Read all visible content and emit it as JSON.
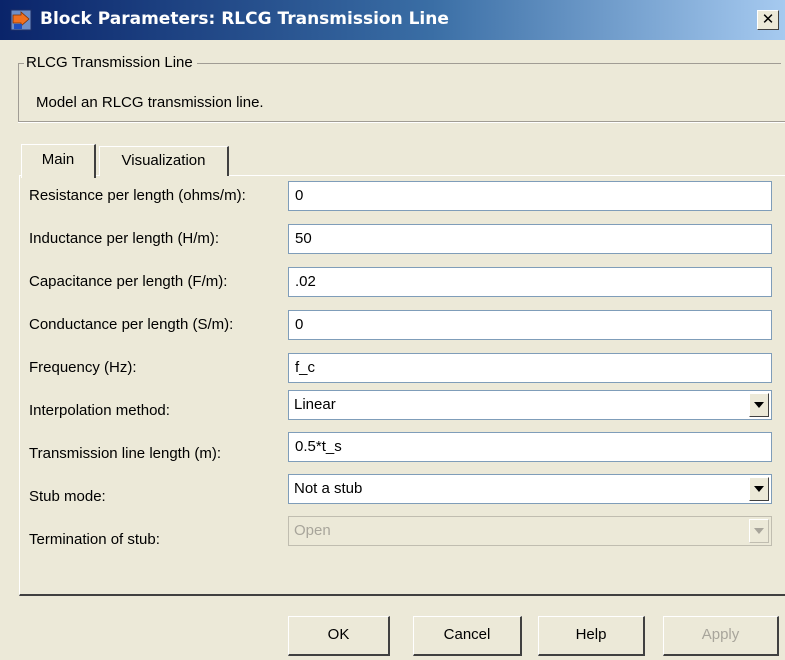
{
  "window": {
    "title": "Block Parameters: RLCG Transmission Line",
    "close_label": "✕"
  },
  "group": {
    "legend": "RLCG Transmission Line",
    "description": "Model an RLCG transmission line."
  },
  "tabs": [
    {
      "label": "Main",
      "active": true
    },
    {
      "label": "Visualization",
      "active": false
    }
  ],
  "params": [
    {
      "label": "Resistance per length (ohms/m):",
      "value": "0"
    },
    {
      "label": "Inductance per length (H/m):",
      "value": "50"
    },
    {
      "label": "Capacitance per length (F/m):",
      "value": ".02"
    },
    {
      "label": "Conductance per length (S/m):",
      "value": "0"
    },
    {
      "label": "Frequency (Hz):",
      "value": "f_c"
    },
    {
      "label": "Interpolation method:",
      "value": "Linear"
    },
    {
      "label": "Transmission line length (m):",
      "value": "0.5*t_s"
    },
    {
      "label": "Stub mode:",
      "value": "Not a stub"
    },
    {
      "label": "Termination of stub:",
      "value": "Open"
    }
  ],
  "buttons": {
    "ok": "OK",
    "cancel": "Cancel",
    "help": "Help",
    "apply": "Apply"
  },
  "icons": {
    "title_icon": "simulink-block-icon",
    "close_icon": "close-icon",
    "dropdown_icon": "chevron-down-icon"
  },
  "colors": {
    "titlebar_start": "#0a246a",
    "titlebar_end": "#a6caf0",
    "dialog_bg": "#ece9d8",
    "field_border": "#7f9db9"
  }
}
